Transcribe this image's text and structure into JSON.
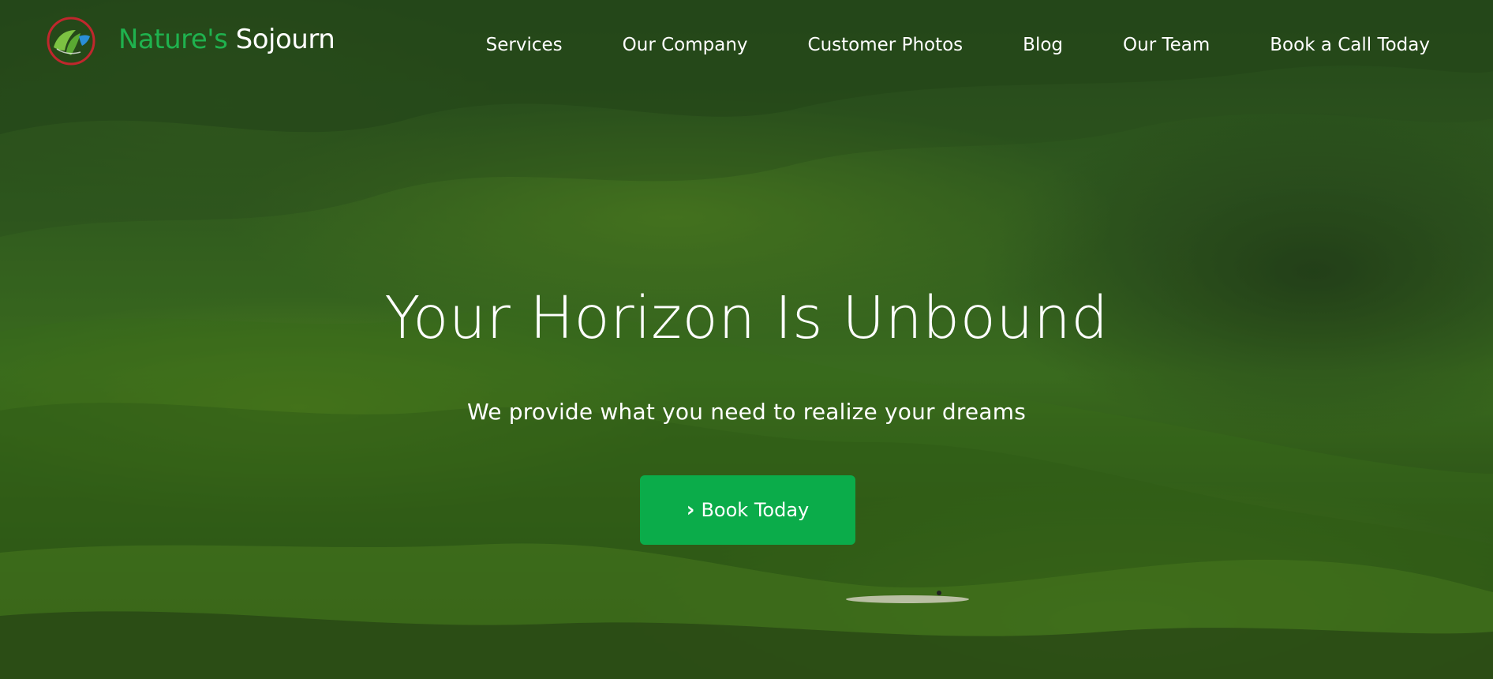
{
  "brand": {
    "name_part1": "Nature's",
    "name_part2": "Sojourn",
    "logo_icon": "leaf-globe-icon"
  },
  "nav": {
    "items": [
      {
        "label": "Services"
      },
      {
        "label": "Our Company"
      },
      {
        "label": "Customer Photos"
      },
      {
        "label": "Blog"
      },
      {
        "label": "Our Team"
      },
      {
        "label": "Book a Call Today"
      }
    ]
  },
  "hero": {
    "headline": "Your Horizon Is Unbound",
    "subheadline": "We provide what you need to realize your dreams",
    "cta_label": "Book Today",
    "cta_icon": "chevron-right-icon"
  },
  "colors": {
    "accent": "#0bac4a",
    "brand_green": "#1fb24e",
    "logo_ring": "#c0272d",
    "logo_blue": "#2a8fd8"
  }
}
